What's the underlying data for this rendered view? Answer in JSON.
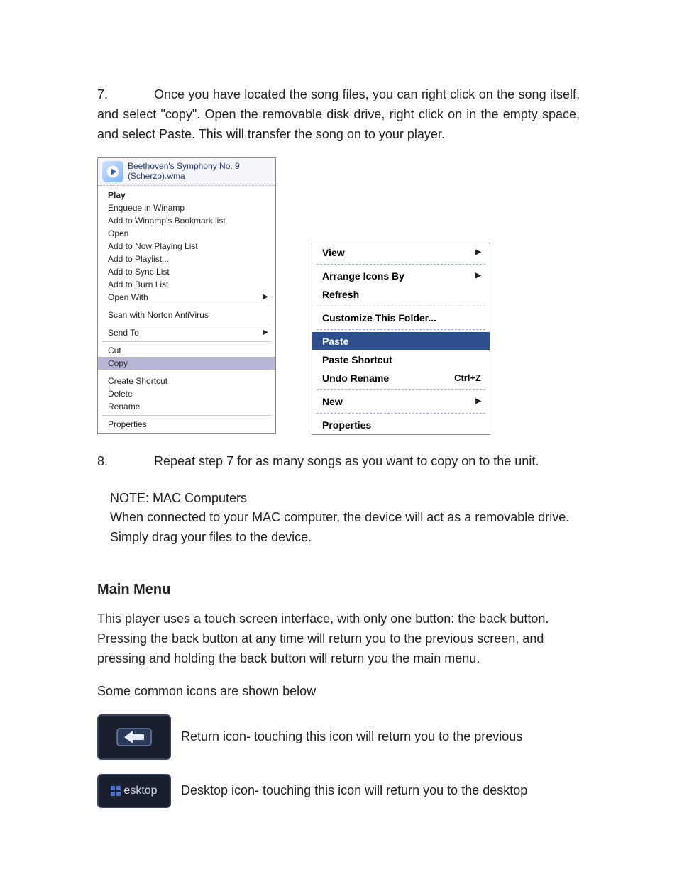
{
  "steps": {
    "s7_num": "7.",
    "s7_text": "Once you have located the song files, you can right click on the song itself, and select \"copy\".  Open the removable disk drive, right click on in the empty space, and select Paste. This will transfer the song on to your player.",
    "s8_num": "8.",
    "s8_text": "Repeat step 7 for as many songs as you want to copy on to the unit."
  },
  "file": {
    "name_line1": "Beethoven's Symphony No. 9",
    "name_line2": "(Scherzo).wma"
  },
  "left_menu": {
    "play": "Play",
    "enqueue": "Enqueue in Winamp",
    "bookmark": "Add to Winamp's Bookmark list",
    "open": "Open",
    "now_playing": "Add to Now Playing List",
    "playlist": "Add to Playlist...",
    "sync": "Add to Sync List",
    "burn": "Add to Burn List",
    "open_with": "Open With",
    "scan": "Scan with Norton AntiVirus",
    "send_to": "Send To",
    "cut": "Cut",
    "copy": "Copy",
    "create_shortcut": "Create Shortcut",
    "delete": "Delete",
    "rename": "Rename",
    "properties": "Properties"
  },
  "right_menu": {
    "view": "View",
    "arrange": "Arrange Icons By",
    "refresh": "Refresh",
    "customize": "Customize This Folder...",
    "paste": "Paste",
    "paste_shortcut": "Paste Shortcut",
    "undo": "Undo Rename",
    "undo_shortcut": "Ctrl+Z",
    "new": "New",
    "properties": "Properties"
  },
  "note": {
    "title": "NOTE: MAC Computers",
    "body": "When connected to your MAC computer, the device will act as a removable drive. Simply drag your files to the device."
  },
  "main_menu": {
    "heading": "Main Menu",
    "p1": "This player uses a touch screen interface, with only one button: the back button. Pressing the back button at any time will return you to the previous screen, and pressing and holding the back button will return you the main menu.",
    "p2": "Some common icons are shown below",
    "return_text": "Return icon- touching this icon will return you to the previous",
    "desktop_text": "Desktop icon- touching this icon will return you to the desktop",
    "desktop_label": "esktop"
  },
  "glyphs": {
    "submenu_arrow": "▶"
  }
}
